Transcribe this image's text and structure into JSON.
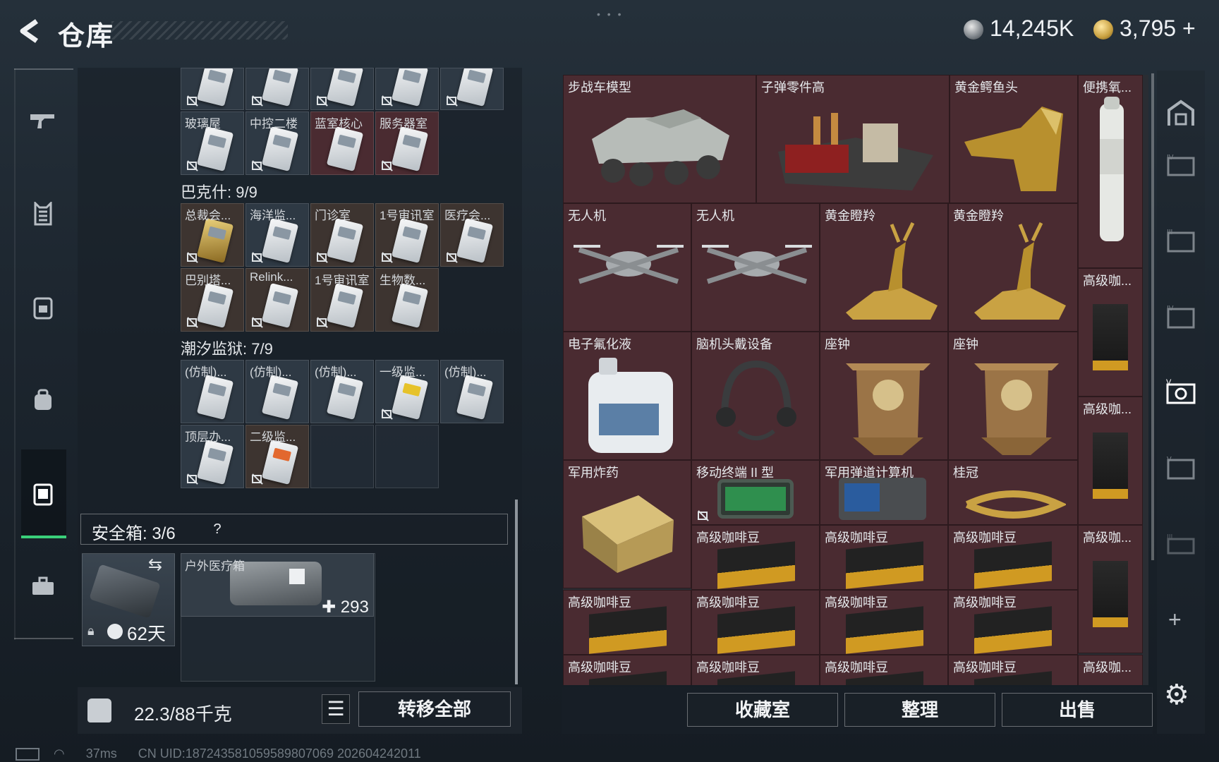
{
  "header": {
    "title": "仓库",
    "currency1": "14,245K",
    "currency2": "3,795",
    "currency2_plus": "+"
  },
  "left_nav": {
    "items": [
      "gun-icon",
      "armor-icon",
      "backpack-icon",
      "bag-icon",
      "container-icon",
      "case-icon"
    ],
    "active": "container-icon"
  },
  "sections": {
    "top_row_labels": [
      "玻璃屋",
      "中控二楼",
      "蓝室核心",
      "服务器室"
    ],
    "bakesh": {
      "title": "巴克什: 9/9",
      "row1": [
        "总裁会...",
        "海洋监...",
        "门诊室",
        "1号审讯室",
        "医疗会..."
      ],
      "row2": [
        "巴别塔...",
        "Relink...",
        "1号审讯室",
        "生物数..."
      ]
    },
    "prison": {
      "title": "潮汐监狱: 7/9",
      "row1": [
        "(仿制)...",
        "(仿制)...",
        "(仿制)...",
        "一级监...",
        "(仿制)..."
      ],
      "row2": [
        "顶层办...",
        "二级监..."
      ]
    }
  },
  "safebox": {
    "label": "安全箱: 3/6",
    "help": "?",
    "days": "62天",
    "item_name": "户外医疗箱",
    "item_count": "293"
  },
  "footer_left": {
    "weight": "22.3/88千克",
    "transfer_all": "转移全部"
  },
  "storage": {
    "items": [
      {
        "name": "步战车模型"
      },
      {
        "name": "子弹零件高"
      },
      {
        "name": "黄金鳄鱼头"
      },
      {
        "name": "便携氧..."
      },
      {
        "name": "无人机"
      },
      {
        "name": "无人机"
      },
      {
        "name": "黄金瞪羚"
      },
      {
        "name": "黄金瞪羚"
      },
      {
        "name": "电子氟化液"
      },
      {
        "name": "脑机头戴设备"
      },
      {
        "name": "座钟"
      },
      {
        "name": "座钟"
      },
      {
        "name": "军用炸药"
      },
      {
        "name": "移动终端 II 型"
      },
      {
        "name": "军用弹道计算机"
      },
      {
        "name": "桂冠"
      },
      {
        "name": "高级咖啡豆"
      },
      {
        "name": "高级咖..."
      }
    ],
    "coffee_label": "高级咖啡豆",
    "coffee_short": "高级咖..."
  },
  "footer_right": {
    "collection": "收藏室",
    "organize": "整理",
    "sell": "出售"
  },
  "status_bar": {
    "ping": "37ms",
    "uid": "CN UID:1872435810595898070​69 2026042420​11"
  }
}
